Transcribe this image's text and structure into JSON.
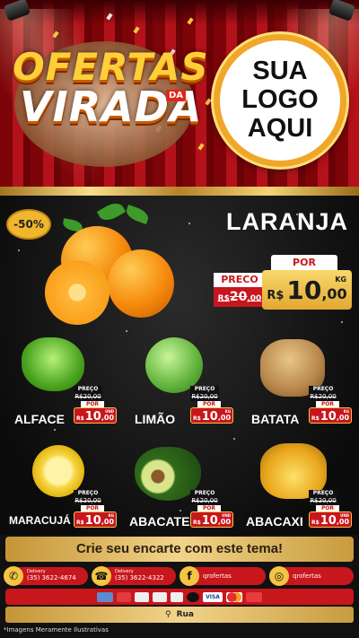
{
  "header": {
    "title_line1": "OFERTAS",
    "title_line2": "VIRADA",
    "title_small": "DA",
    "logo_line1": "SUA",
    "logo_line2": "LOGO",
    "logo_line3": "AQUI"
  },
  "hero": {
    "badge": "-50%",
    "name": "LARANJA",
    "preco_label": "PRECO",
    "old_price": "R$20,00",
    "old_int": "20",
    "old_dec": ",00",
    "old_rs": "R$",
    "por_label": "POR",
    "price_rs": "R$",
    "price_int": "10",
    "price_dec": ",00",
    "unit": "KG"
  },
  "products": [
    {
      "name": "ALFACE",
      "preco": "PREÇO",
      "old": "R$20,00",
      "por": "POR",
      "rs": "R$",
      "int": "10",
      "dec": ",00",
      "unit": "UND"
    },
    {
      "name": "LIMÃO",
      "preco": "PREÇO",
      "old": "R$20,00",
      "por": "POR",
      "rs": "R$",
      "int": "10",
      "dec": ",00",
      "unit": "KG"
    },
    {
      "name": "BATATA",
      "preco": "PREÇO",
      "old": "R$20,00",
      "por": "POR",
      "rs": "R$",
      "int": "10",
      "dec": ",00",
      "unit": "KG"
    },
    {
      "name": "MARACUJÁ",
      "preco": "PREÇO",
      "old": "R$20,00",
      "por": "POR",
      "rs": "R$",
      "int": "10",
      "dec": ",00",
      "unit": "KG"
    },
    {
      "name": "ABACATE",
      "preco": "PREÇO",
      "old": "R$20,00",
      "por": "POR",
      "rs": "R$",
      "int": "10",
      "dec": ",00",
      "unit": "UND"
    },
    {
      "name": "ABACAXI",
      "preco": "PREÇO",
      "old": "R$20,00",
      "por": "POR",
      "rs": "R$",
      "int": "10",
      "dec": ",00",
      "unit": "UND"
    }
  ],
  "cta": "Crie seu encarte com este tema!",
  "contacts": {
    "delivery1_label": "Delivery",
    "delivery1_phone": "(35) 3622-4674",
    "delivery2_label": "Delivery",
    "delivery2_phone": "(35) 3622-4322",
    "facebook": "qrofertas",
    "instagram": "qrofertas"
  },
  "payments": [
    "",
    "",
    "",
    "",
    "",
    "",
    "VISA",
    "",
    ""
  ],
  "address": "Rua",
  "disclaimer": "*Imagens Meramente Ilustrativas",
  "colors": {
    "red": "#c8161d",
    "gold": "#f4c542",
    "curtain": "#b4121a",
    "background": "#111111"
  }
}
